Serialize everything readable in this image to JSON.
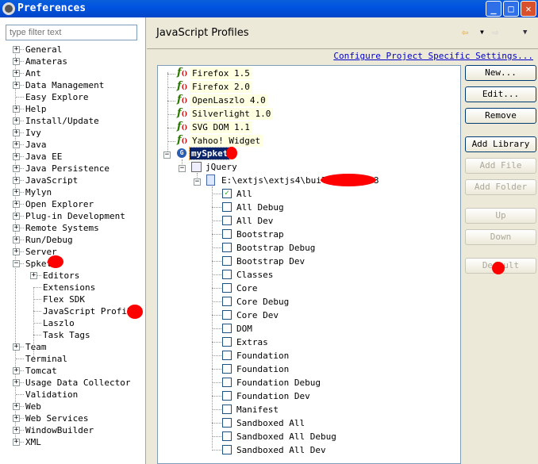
{
  "window": {
    "title": "Preferences",
    "minimize": "_",
    "maximize": "□",
    "close": "✕"
  },
  "filter": {
    "placeholder": "type filter text"
  },
  "nav": [
    {
      "label": "General",
      "exp": "+"
    },
    {
      "label": "Amateras",
      "exp": "+"
    },
    {
      "label": "Ant",
      "exp": "+"
    },
    {
      "label": "Data Management",
      "exp": "+"
    },
    {
      "label": "Easy Explore",
      "exp": ""
    },
    {
      "label": "Help",
      "exp": "+"
    },
    {
      "label": "Install/Update",
      "exp": "+"
    },
    {
      "label": "Ivy",
      "exp": "+"
    },
    {
      "label": "Java",
      "exp": "+"
    },
    {
      "label": "Java EE",
      "exp": "+"
    },
    {
      "label": "Java Persistence",
      "exp": "+"
    },
    {
      "label": "JavaScript",
      "exp": "+"
    },
    {
      "label": "Mylyn",
      "exp": "+"
    },
    {
      "label": "Open Explorer",
      "exp": "+"
    },
    {
      "label": "Plug-in Development",
      "exp": "+"
    },
    {
      "label": "Remote Systems",
      "exp": "+"
    },
    {
      "label": "Run/Debug",
      "exp": "+"
    },
    {
      "label": "Server",
      "exp": "+"
    },
    {
      "label": "Spket",
      "exp": "-"
    },
    {
      "label": "Editors",
      "exp": "+",
      "child": true
    },
    {
      "label": "Extensions",
      "exp": "",
      "child": true
    },
    {
      "label": "Flex SDK",
      "exp": "",
      "child": true
    },
    {
      "label": "JavaScript Profiles",
      "exp": "",
      "child": true,
      "selected": true
    },
    {
      "label": "Laszlo",
      "exp": "",
      "child": true
    },
    {
      "label": "Task Tags",
      "exp": "",
      "child": true
    },
    {
      "label": "Team",
      "exp": "+"
    },
    {
      "label": "Terminal",
      "exp": ""
    },
    {
      "label": "Tomcat",
      "exp": "+"
    },
    {
      "label": "Usage Data Collector",
      "exp": "+"
    },
    {
      "label": "Validation",
      "exp": ""
    },
    {
      "label": "Web",
      "exp": "+"
    },
    {
      "label": "Web Services",
      "exp": "+"
    },
    {
      "label": "WindowBuilder",
      "exp": "+"
    },
    {
      "label": "XML",
      "exp": "+"
    }
  ],
  "page": {
    "title": "JavaScript Profiles",
    "configure_link": "Configure Project Specific Settings..."
  },
  "profiles": [
    "Firefox 1.5",
    "Firefox 2.0",
    "OpenLaszlo 4.0",
    "Silverlight 1.0",
    "SVG DOM 1.1",
    "Yahoo! Widget"
  ],
  "user_profile": {
    "label": "mySpket",
    "library": "jQuery",
    "file": "E:\\extjs\\extjs4\\build\\sdk.jsb3"
  },
  "packages": [
    {
      "label": "All",
      "checked": true
    },
    {
      "label": "All Debug",
      "checked": false
    },
    {
      "label": "All Dev",
      "checked": false
    },
    {
      "label": "Bootstrap",
      "checked": false
    },
    {
      "label": "Bootstrap Debug",
      "checked": false
    },
    {
      "label": "Bootstrap Dev",
      "checked": false
    },
    {
      "label": "Classes",
      "checked": false
    },
    {
      "label": "Core",
      "checked": false
    },
    {
      "label": "Core Debug",
      "checked": false
    },
    {
      "label": "Core Dev",
      "checked": false
    },
    {
      "label": "DOM",
      "checked": false
    },
    {
      "label": "Extras",
      "checked": false
    },
    {
      "label": "Foundation",
      "checked": false
    },
    {
      "label": "Foundation",
      "checked": false
    },
    {
      "label": "Foundation Debug",
      "checked": false
    },
    {
      "label": "Foundation Dev",
      "checked": false
    },
    {
      "label": "Manifest",
      "checked": false
    },
    {
      "label": "Sandboxed All",
      "checked": false
    },
    {
      "label": "Sandboxed All Debug",
      "checked": false
    },
    {
      "label": "Sandboxed All Dev",
      "checked": false
    }
  ],
  "buttons": [
    {
      "label": "New...",
      "enabled": true
    },
    {
      "label": "Edit...",
      "enabled": true
    },
    {
      "label": "Remove",
      "enabled": true
    },
    {
      "label": "Add Library",
      "enabled": true
    },
    {
      "label": "Add File",
      "enabled": false
    },
    {
      "label": "Add Folder",
      "enabled": false
    },
    {
      "label": "Up",
      "enabled": false
    },
    {
      "label": "Down",
      "enabled": false
    },
    {
      "label": "Default",
      "enabled": false
    }
  ],
  "colors": {
    "selection": "#0a246a",
    "link": "#0000cc",
    "annotation": "#ff0000"
  }
}
